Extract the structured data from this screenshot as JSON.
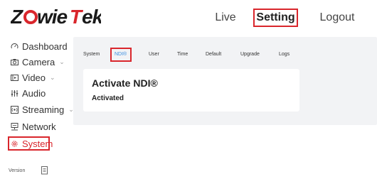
{
  "header": {
    "logo_text": "ZowieTek",
    "nav": [
      {
        "label": "Live"
      },
      {
        "label": "Setting"
      },
      {
        "label": "Logout"
      }
    ]
  },
  "sidebar": {
    "items": [
      {
        "label": "Dashboard",
        "icon": "dashboard-icon",
        "chevron": ""
      },
      {
        "label": "Camera",
        "icon": "camera-icon",
        "chevron": "⌄"
      },
      {
        "label": "Video",
        "icon": "video-icon",
        "chevron": "⌄"
      },
      {
        "label": "Audio",
        "icon": "audio-icon",
        "chevron": ""
      },
      {
        "label": "Streaming",
        "icon": "streaming-icon",
        "chevron": "⌄"
      },
      {
        "label": "Network",
        "icon": "network-icon",
        "chevron": ""
      },
      {
        "label": "System",
        "icon": "system-gear-icon",
        "chevron": ""
      }
    ],
    "version_label": "Version"
  },
  "tabs": [
    {
      "label": "System"
    },
    {
      "label": "NDI®"
    },
    {
      "label": "User"
    },
    {
      "label": "Time"
    },
    {
      "label": "Default"
    },
    {
      "label": "Upgrade"
    },
    {
      "label": "Logs"
    }
  ],
  "card": {
    "title": "Activate NDI®",
    "status": "Activated"
  },
  "colors": {
    "accent_red": "#d9262c",
    "active_tab_blue": "#3b8fe0",
    "panel_bg": "#f2f3f5"
  }
}
